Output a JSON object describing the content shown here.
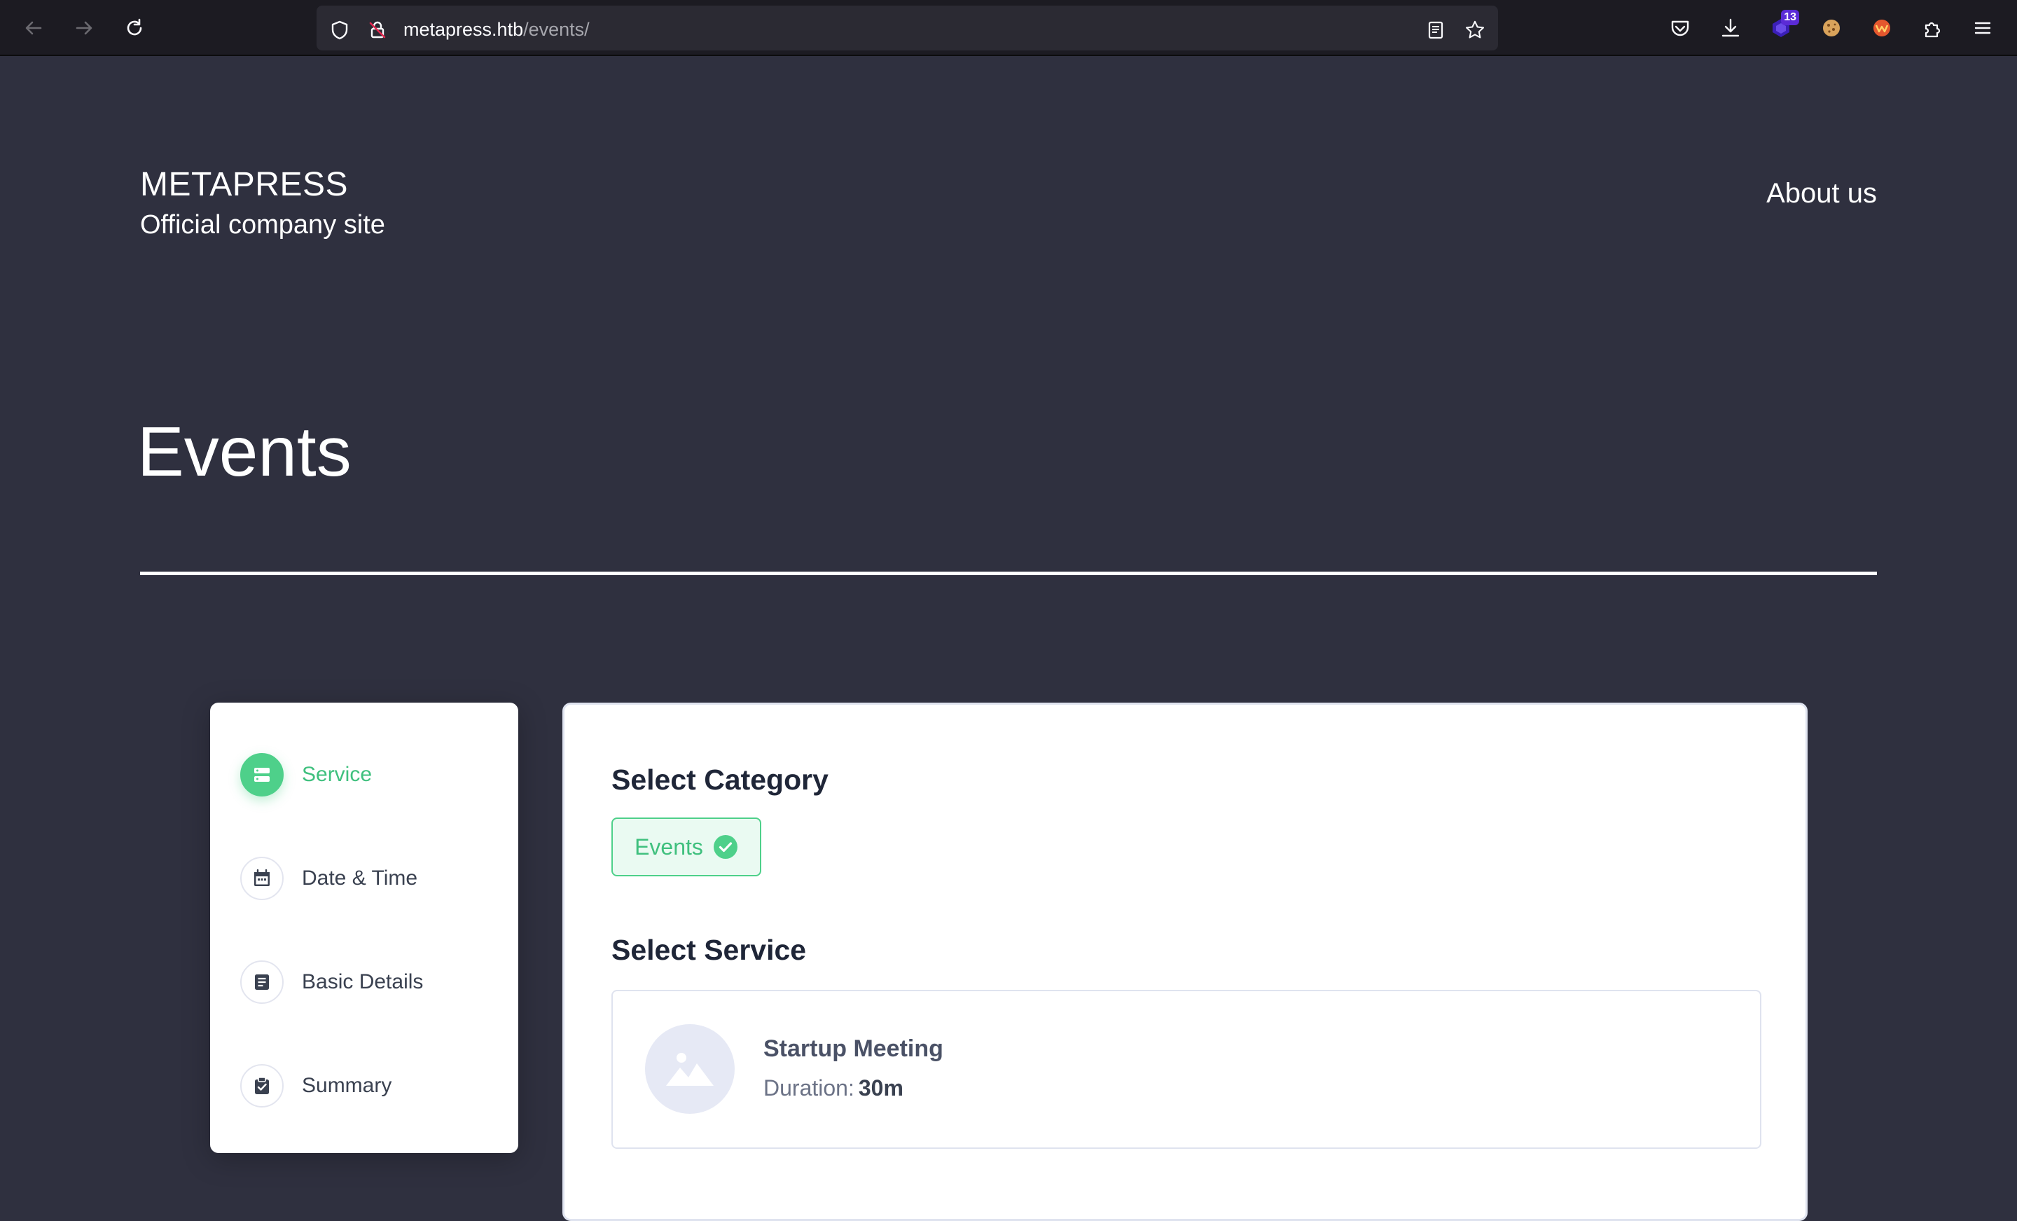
{
  "browser": {
    "url_host": "metapress.htb",
    "url_path": "/events/",
    "extension_badge": "13",
    "icons": {
      "back": "arrow-left-icon",
      "forward": "arrow-right-icon",
      "reload": "reload-icon",
      "tracking": "shield-icon",
      "insecure": "insecure-lock-icon",
      "reader": "reader-view-icon",
      "bookmark": "star-icon",
      "pocket": "pocket-icon",
      "downloads": "download-icon",
      "extensions": "puzzle-icon",
      "menu": "hamburger-menu-icon"
    }
  },
  "header": {
    "brand_title": "METAPRESS",
    "brand_tagline": "Official company site",
    "about_link": "About us"
  },
  "page": {
    "heading": "Events"
  },
  "steps": {
    "items": [
      {
        "label": "Service",
        "icon": "service-icon",
        "active": true
      },
      {
        "label": "Date & Time",
        "icon": "calendar-icon",
        "active": false
      },
      {
        "label": "Basic Details",
        "icon": "document-icon",
        "active": false
      },
      {
        "label": "Summary",
        "icon": "clipboard-check-icon",
        "active": false
      }
    ]
  },
  "booking": {
    "category_heading": "Select Category",
    "category_chip": "Events",
    "service_heading": "Select Service",
    "service": {
      "name": "Startup Meeting",
      "duration_label": "Duration:",
      "duration_value": "30m"
    }
  },
  "colors": {
    "page_bg": "#2f303f",
    "accent_green": "#4ed08a",
    "chrome_bg": "#1c1b22"
  }
}
